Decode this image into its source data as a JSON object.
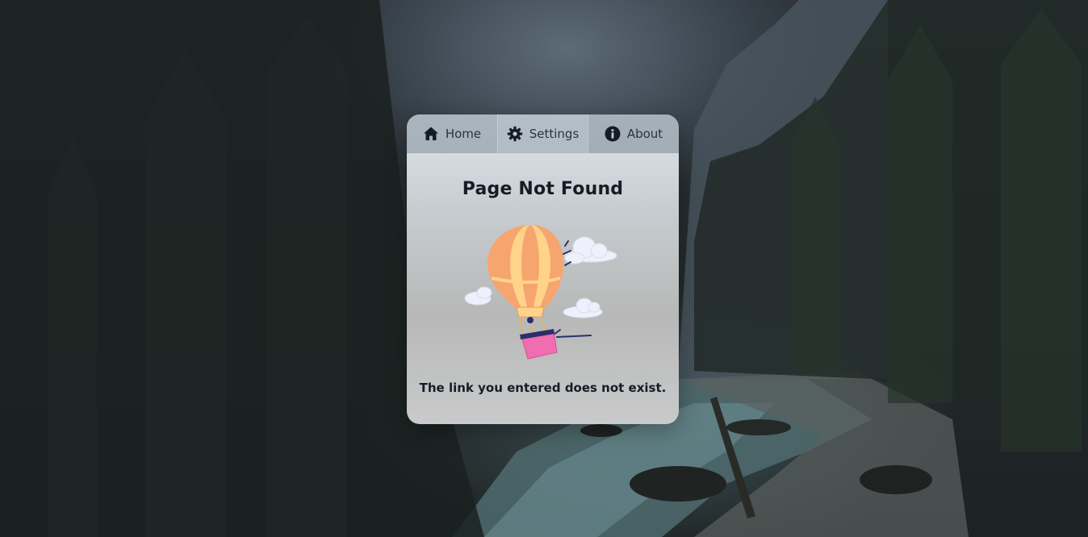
{
  "nav": {
    "tabs": [
      {
        "label": "Home",
        "icon": "home-icon"
      },
      {
        "label": "Settings",
        "icon": "gear-icon"
      },
      {
        "label": "About",
        "icon": "info-icon"
      }
    ]
  },
  "content": {
    "title": "Page Not Found",
    "message": "The link you entered does not exist.",
    "illustration": "hot-air-balloon-illustration"
  },
  "colors": {
    "text": "#161c26",
    "balloon_stripe_a": "#f6a56f",
    "balloon_stripe_b": "#ffd38a",
    "basket": "#f06db0"
  }
}
